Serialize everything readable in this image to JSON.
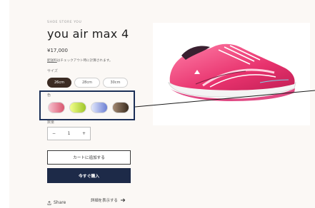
{
  "product": {
    "store_name": "SHOE STORE YOU",
    "title": "you air max 4",
    "price": "¥17,000",
    "tax_link": "配送料",
    "tax_rest": "はチェックアウト時に計算されます。"
  },
  "size": {
    "label": "サイズ",
    "options": [
      "26cm",
      "28cm",
      "30cm"
    ],
    "selected": "26cm"
  },
  "color": {
    "label": "色",
    "swatches": [
      {
        "name": "pink",
        "gradient": [
          "#f7c2cf",
          "#d9556e"
        ]
      },
      {
        "name": "lime",
        "gradient": [
          "#f3ff8c",
          "#9fc62a"
        ]
      },
      {
        "name": "blue",
        "gradient": [
          "#e2e7fb",
          "#6c7fd4"
        ]
      },
      {
        "name": "brown",
        "gradient": [
          "#a58b74",
          "#3a2b1e"
        ]
      }
    ],
    "highlight_color": "#1b2f57"
  },
  "quantity": {
    "label": "数量",
    "value": "1",
    "minus": "−",
    "plus": "+"
  },
  "actions": {
    "add_to_cart": "カートに追加する",
    "buy_now": "今すぐ購入",
    "buy_now_color": "#1d2a48"
  },
  "footer": {
    "share": "Share",
    "details": "詳細を表示する"
  }
}
